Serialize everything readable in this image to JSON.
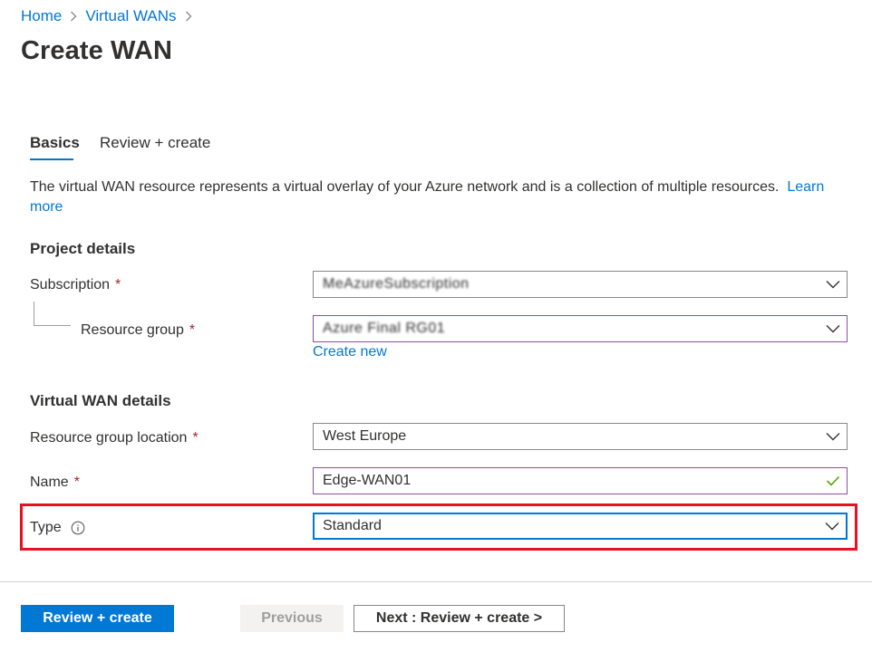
{
  "breadcrumb": {
    "items": [
      {
        "label": "Home"
      },
      {
        "label": "Virtual WANs"
      }
    ]
  },
  "page": {
    "title": "Create WAN"
  },
  "tabs": [
    {
      "label": "Basics",
      "selected": true
    },
    {
      "label": "Review + create",
      "selected": false
    }
  ],
  "description": {
    "text": "The virtual WAN resource represents a virtual overlay of your Azure network and is a collection of multiple resources.",
    "learn_more": "Learn more"
  },
  "project_details": {
    "title": "Project details",
    "subscription": {
      "label": "Subscription",
      "required": "*",
      "value": "MeAzureSubscription"
    },
    "resource_group": {
      "label": "Resource group",
      "required": "*",
      "value": "Azure Final RG01",
      "create_new": "Create new"
    }
  },
  "wan_details": {
    "title": "Virtual WAN details",
    "location": {
      "label": "Resource group location",
      "required": "*",
      "value": "West Europe"
    },
    "name": {
      "label": "Name",
      "required": "*",
      "value": "Edge-WAN01"
    },
    "type": {
      "label": "Type",
      "value": "Standard"
    }
  },
  "footer": {
    "review_create": "Review + create",
    "previous": "Previous",
    "next": "Next : Review + create >"
  },
  "colors": {
    "accent": "#0078d4",
    "required": "#a4262c",
    "highlight": "#e81123",
    "valid": "#57a300"
  },
  "icons": {
    "breadcrumb_separator": "chevron-right-icon",
    "dropdown": "chevron-down-icon",
    "valid": "checkmark-icon",
    "info": "info-icon"
  }
}
